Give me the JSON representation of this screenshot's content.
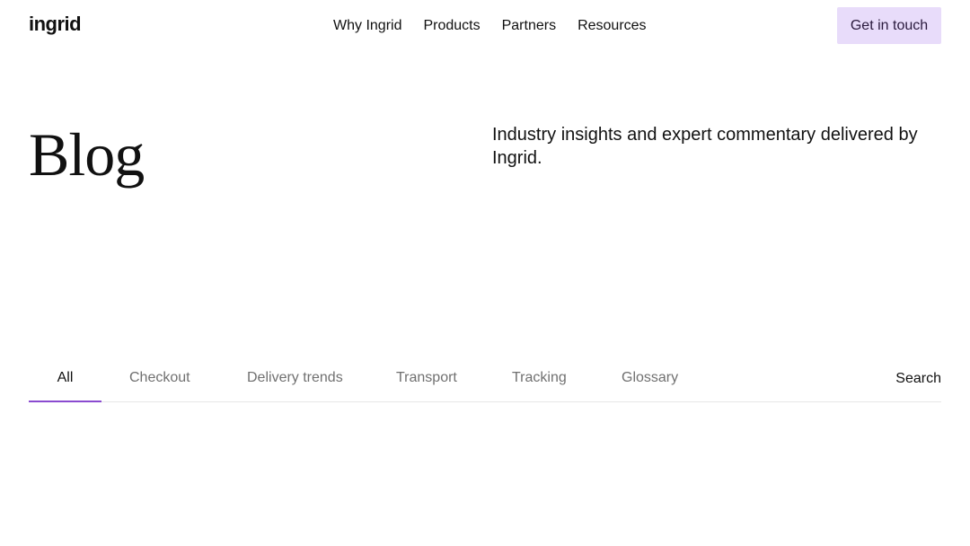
{
  "header": {
    "logo_text": "ingrid",
    "nav": [
      "Why Ingrid",
      "Products",
      "Partners",
      "Resources"
    ],
    "cta_label": "Get in touch"
  },
  "hero": {
    "title": "Blog",
    "description": "Industry insights and expert commentary delivered by Ingrid."
  },
  "tabs": {
    "items": [
      "All",
      "Checkout",
      "Delivery trends",
      "Transport",
      "Tracking",
      "Glossary"
    ],
    "active": "All",
    "search_label": "Search"
  },
  "colors": {
    "cta_background": "#e8dcfa",
    "active_tab_underline": "#8a4bd0",
    "inactive_tab_text": "#707070"
  }
}
